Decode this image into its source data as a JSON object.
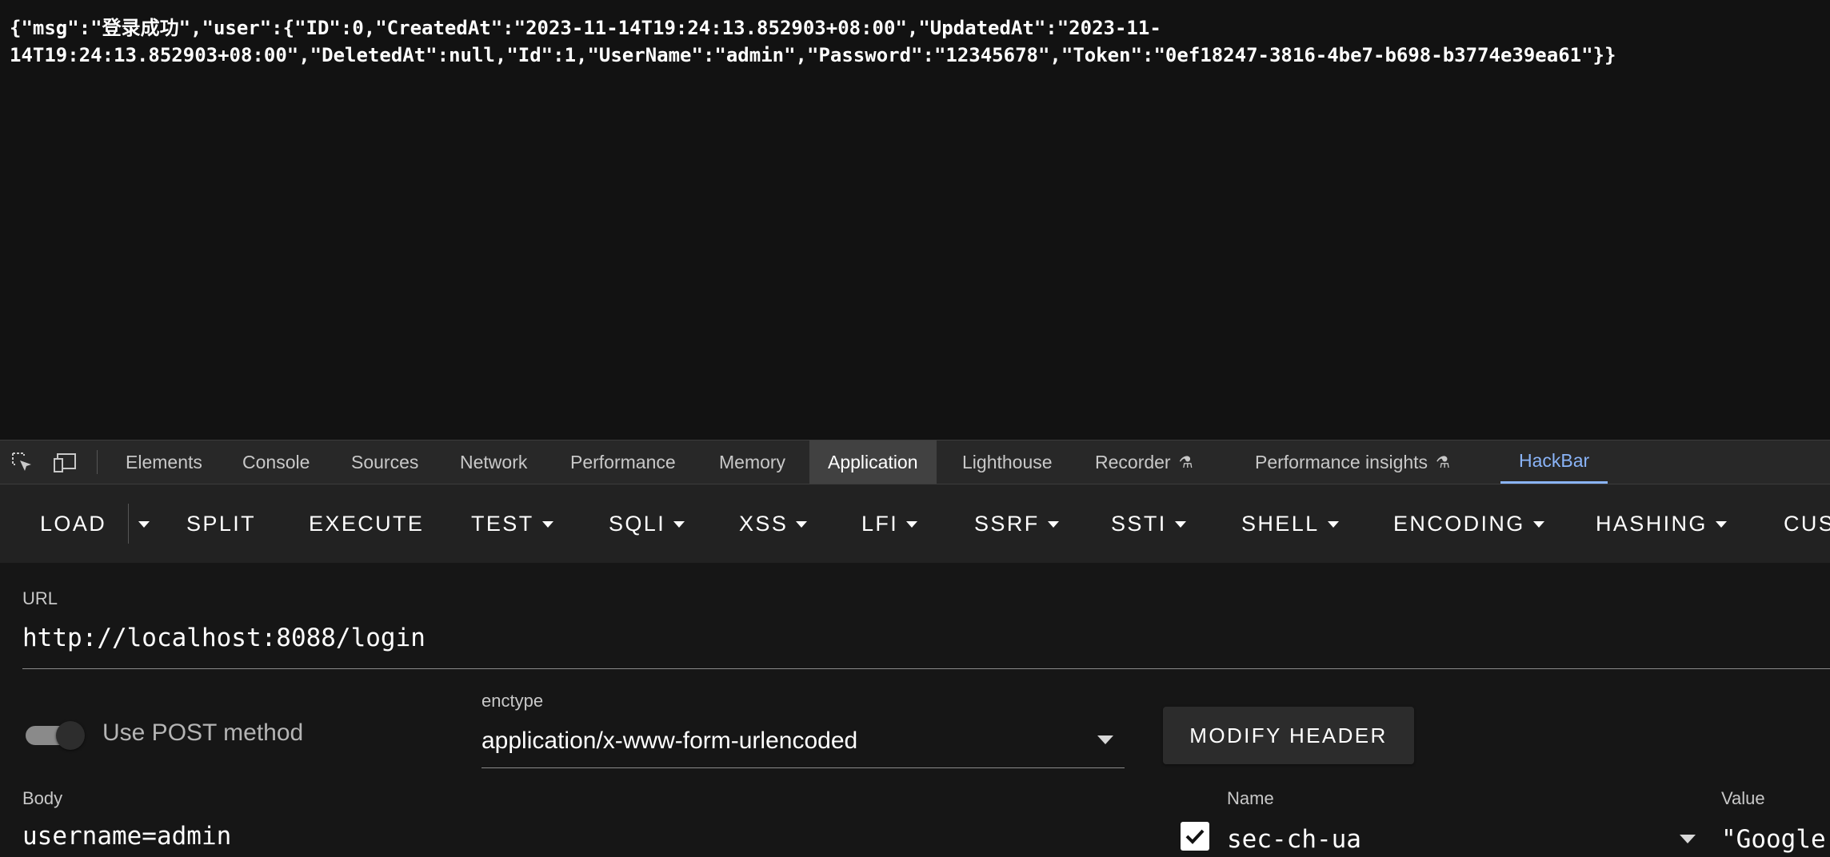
{
  "response": {
    "line1": "{\"msg\":\"登录成功\",\"user\":{\"ID\":0,\"CreatedAt\":\"2023-11-14T19:24:13.852903+08:00\",\"UpdatedAt\":\"2023-11-",
    "line2": "14T19:24:13.852903+08:00\",\"DeletedAt\":null,\"Id\":1,\"UserName\":\"admin\",\"Password\":\"12345678\",\"Token\":\"0ef18247-3816-4be7-b698-b3774e39ea61\"}}"
  },
  "devtools": {
    "tabs": [
      {
        "label": "Elements"
      },
      {
        "label": "Console"
      },
      {
        "label": "Sources"
      },
      {
        "label": "Network"
      },
      {
        "label": "Performance"
      },
      {
        "label": "Memory"
      },
      {
        "label": "Application",
        "active": true
      },
      {
        "label": "Lighthouse"
      },
      {
        "label": "Recorder",
        "experimental": true
      },
      {
        "label": "Performance insights",
        "experimental": true
      },
      {
        "label": "HackBar",
        "selected": true
      }
    ]
  },
  "hackbar": {
    "menu": [
      "LOAD",
      "SPLIT",
      "EXECUTE",
      "TEST",
      "SQLI",
      "XSS",
      "LFI",
      "SSRF",
      "SSTI",
      "SHELL",
      "ENCODING",
      "HASHING",
      "CUS"
    ],
    "url_label": "URL",
    "url_value": "http://localhost:8088/login",
    "use_post_label": "Use POST method",
    "use_post_enabled": true,
    "enctype_label": "enctype",
    "enctype_value": "application/x-www-form-urlencoded",
    "modify_header_label": "MODIFY HEADER",
    "body_label": "Body",
    "body_value": "username=admin",
    "headers_name_label": "Name",
    "headers_value_label": "Value",
    "header_row": {
      "checked": true,
      "name": "sec-ch-ua",
      "value": "\"Google"
    }
  },
  "colors": {
    "background": "#121212",
    "toolbar": "#282828",
    "accent": "#8ab4f8"
  }
}
